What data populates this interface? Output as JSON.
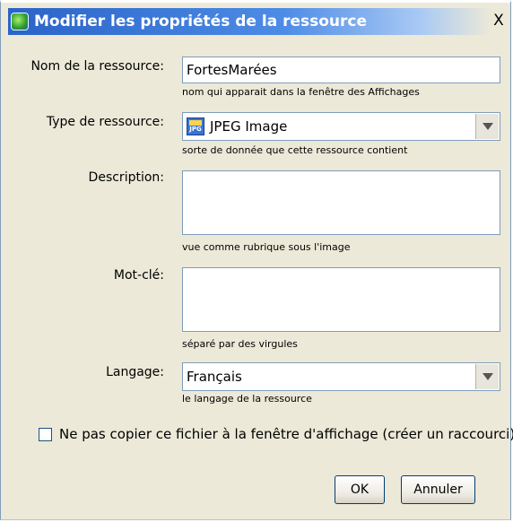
{
  "window": {
    "title": "Modifier les propriétés de la ressource",
    "close_label": "X"
  },
  "form": {
    "name": {
      "label": "Nom de la ressource:",
      "value": "FortesMarées",
      "hint": "nom qui apparait dans la fenêtre des Affichages"
    },
    "type": {
      "label": "Type de ressource:",
      "value": "JPEG Image",
      "icon": "jpeg-file-icon",
      "icon_text": "JPG",
      "hint": "sorte de donnée que cette ressource contient"
    },
    "description": {
      "label": "Description:",
      "value": "",
      "hint": "vue comme rubrique sous l'image"
    },
    "keyword": {
      "label": "Mot-clé:",
      "value": "",
      "hint": "séparé par des virgules"
    },
    "language": {
      "label": "Langage:",
      "value": "Français",
      "hint": "le langage de la ressource"
    },
    "no_copy_checkbox": {
      "label": "Ne pas copier ce fichier à la fenêtre d'affichage (créer un raccourci)",
      "checked": false
    }
  },
  "buttons": {
    "ok": "OK",
    "cancel": "Annuler"
  },
  "colors": {
    "title_bar": "#2a63c8",
    "dialog_background": "#ece9d8",
    "field_border": "#7f9db9"
  }
}
